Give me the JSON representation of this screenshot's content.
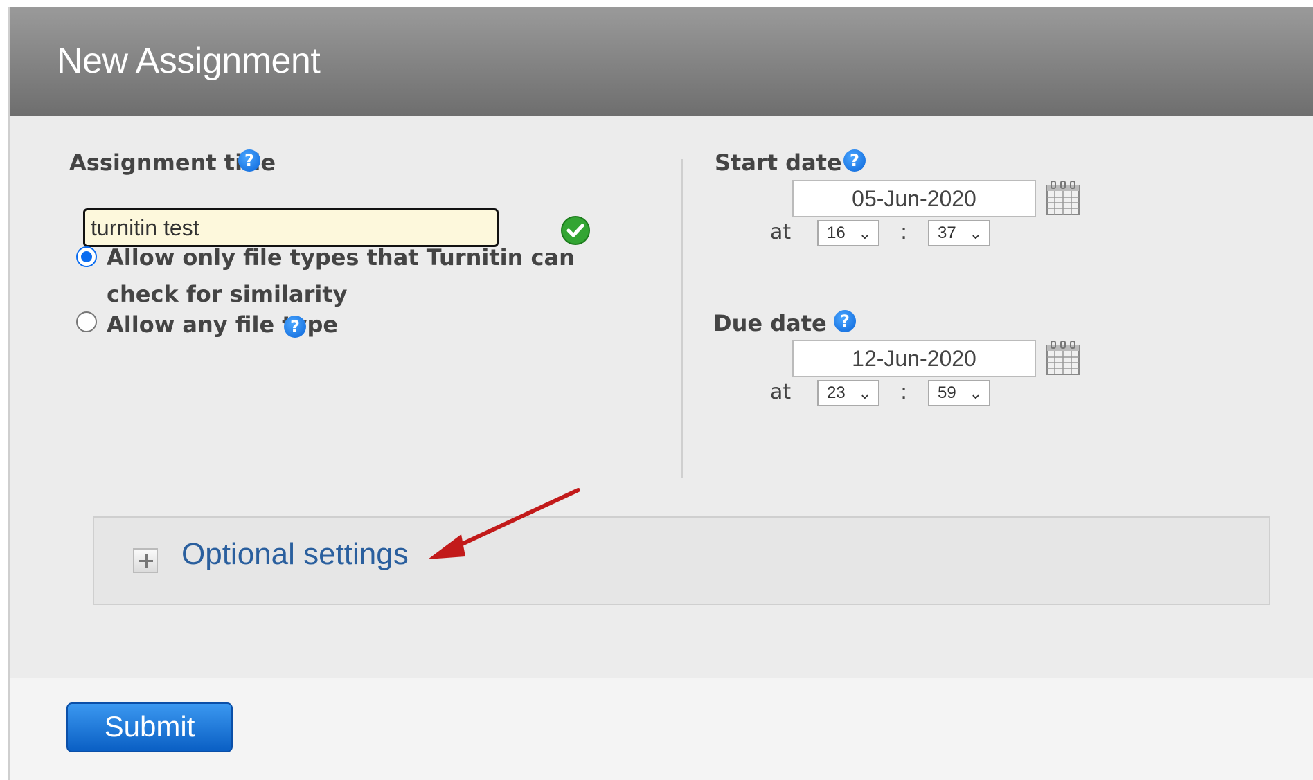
{
  "header": {
    "title": "New Assignment"
  },
  "left": {
    "assignment_title_label": "Assignment title",
    "title_value": "turnitin test",
    "options": [
      {
        "line1": "Allow only file types that Turnitin can",
        "line2": "check for similarity",
        "checked": true
      },
      {
        "line1": "Allow any file type",
        "checked": false
      }
    ]
  },
  "right": {
    "start_label": "Start date",
    "start_value": "05-Jun-2020",
    "start_hour": "16",
    "start_minute": "37",
    "due_label": "Due date",
    "due_value": "12-Jun-2020",
    "due_hour": "23",
    "due_minute": "59",
    "at_label": "at",
    "colon": ":"
  },
  "optional_settings": {
    "label": "Optional settings"
  },
  "footer": {
    "submit_label": "Submit"
  },
  "icons": {
    "help": "help-icon",
    "valid": "checkmark-icon",
    "calendar": "calendar-icon",
    "expand": "plus-icon",
    "annotation": "red-arrow"
  },
  "colors": {
    "header": "#7a7a7a",
    "accent": "#0a6cf0",
    "link": "#2a5f9e",
    "submit": "#1a75d8"
  }
}
